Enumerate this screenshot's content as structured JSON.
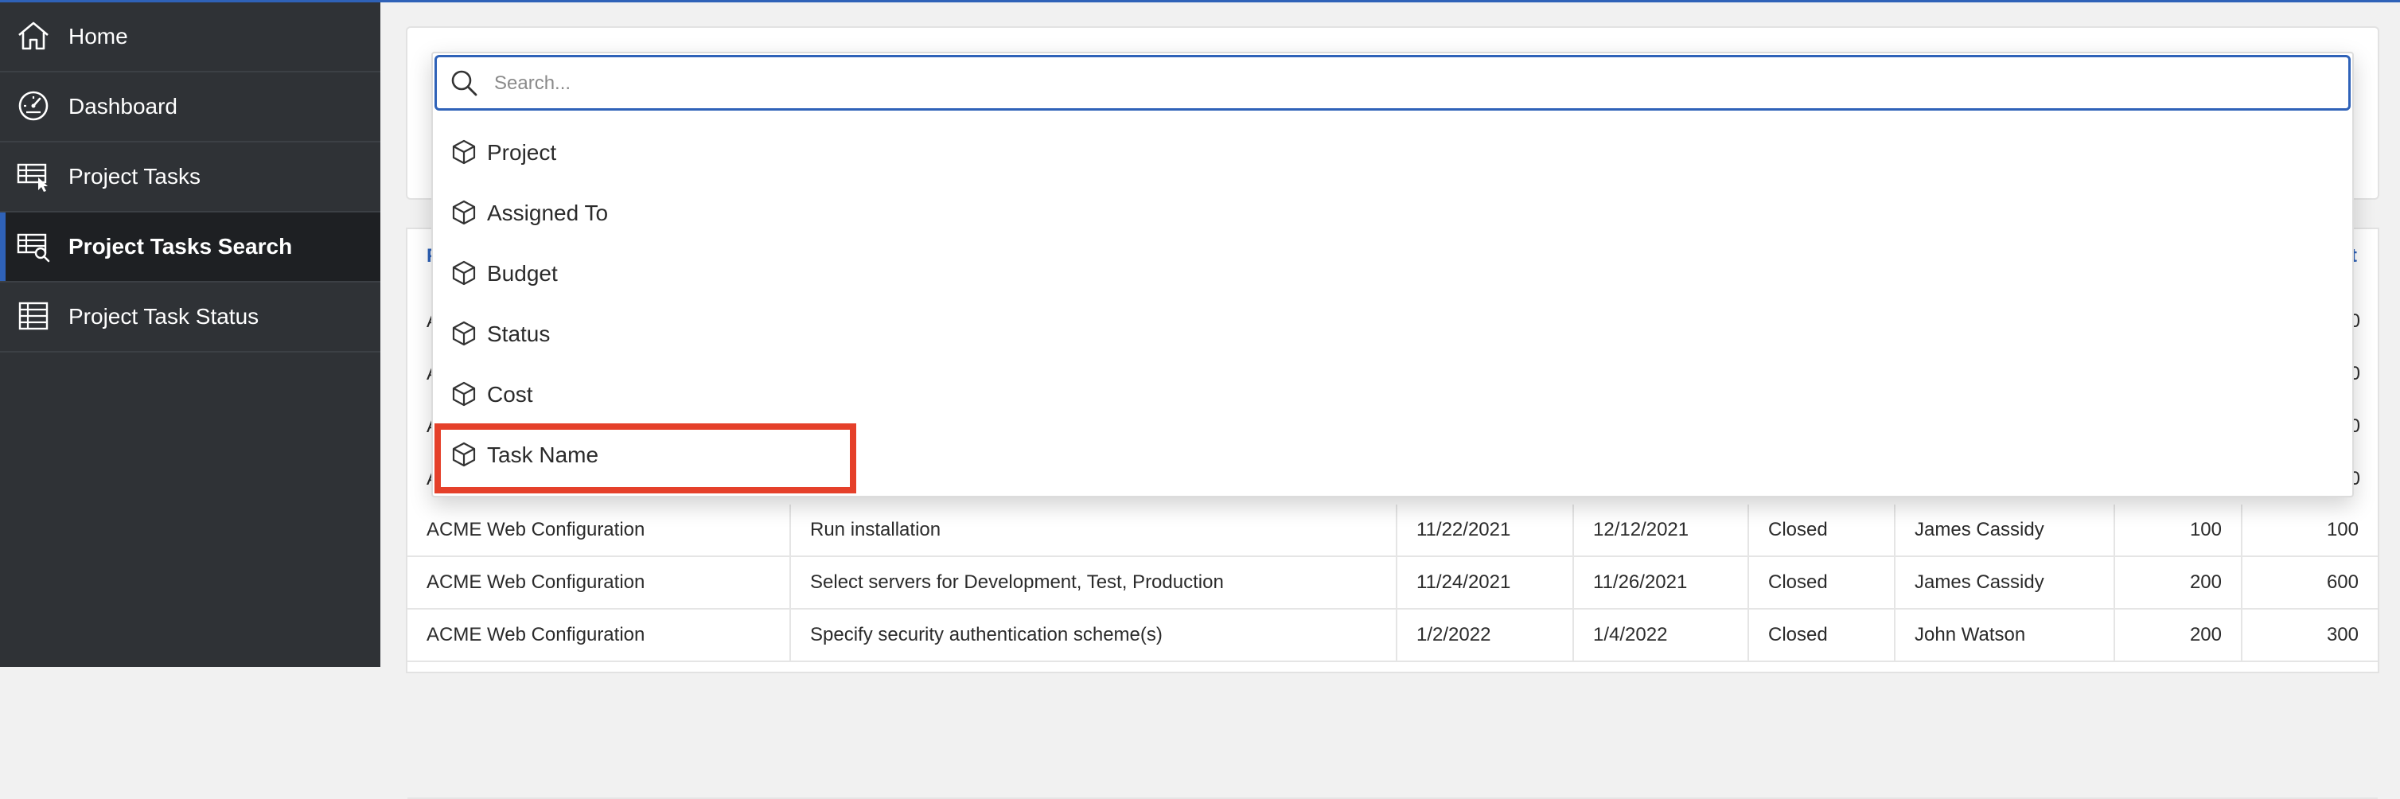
{
  "colors": {
    "accent": "#2f62b8",
    "highlight": "#e5402a",
    "sidebar": "#2f3236"
  },
  "sidebar": {
    "items": [
      {
        "label": "Home",
        "icon": "home-icon"
      },
      {
        "label": "Dashboard",
        "icon": "dashboard-icon"
      },
      {
        "label": "Project Tasks",
        "icon": "table-cursor-icon"
      },
      {
        "label": "Project Tasks Search",
        "icon": "table-search-icon",
        "active": true
      },
      {
        "label": "Project Task Status",
        "icon": "table-icon"
      }
    ]
  },
  "search": {
    "placeholder": "Search..."
  },
  "search_options": [
    {
      "label": "Project",
      "icon": "cube-icon"
    },
    {
      "label": "Assigned To",
      "icon": "cube-icon"
    },
    {
      "label": "Budget",
      "icon": "cube-icon"
    },
    {
      "label": "Status",
      "icon": "cube-icon"
    },
    {
      "label": "Cost",
      "icon": "cube-icon"
    },
    {
      "label": "Task Name",
      "icon": "cube-icon",
      "highlighted": true
    }
  ],
  "report": {
    "header_fragments": {
      "left": "P",
      "right": "t"
    },
    "hidden_rows_left": [
      "A",
      "A",
      "A",
      "A"
    ],
    "hidden_rows_right": [
      "0",
      "0",
      "0",
      "0"
    ],
    "rows": [
      [
        "ACME Web Configuration",
        "Run installation",
        "11/22/2021",
        "12/12/2021",
        "Closed",
        "James Cassidy",
        "100",
        "100"
      ],
      [
        "ACME Web Configuration",
        "Select servers for Development, Test, Production",
        "11/24/2021",
        "11/26/2021",
        "Closed",
        "James Cassidy",
        "200",
        "600"
      ],
      [
        "ACME Web Configuration",
        "Specify security authentication scheme(s)",
        "1/2/2022",
        "1/4/2022",
        "Closed",
        "John Watson",
        "200",
        "300"
      ]
    ]
  }
}
